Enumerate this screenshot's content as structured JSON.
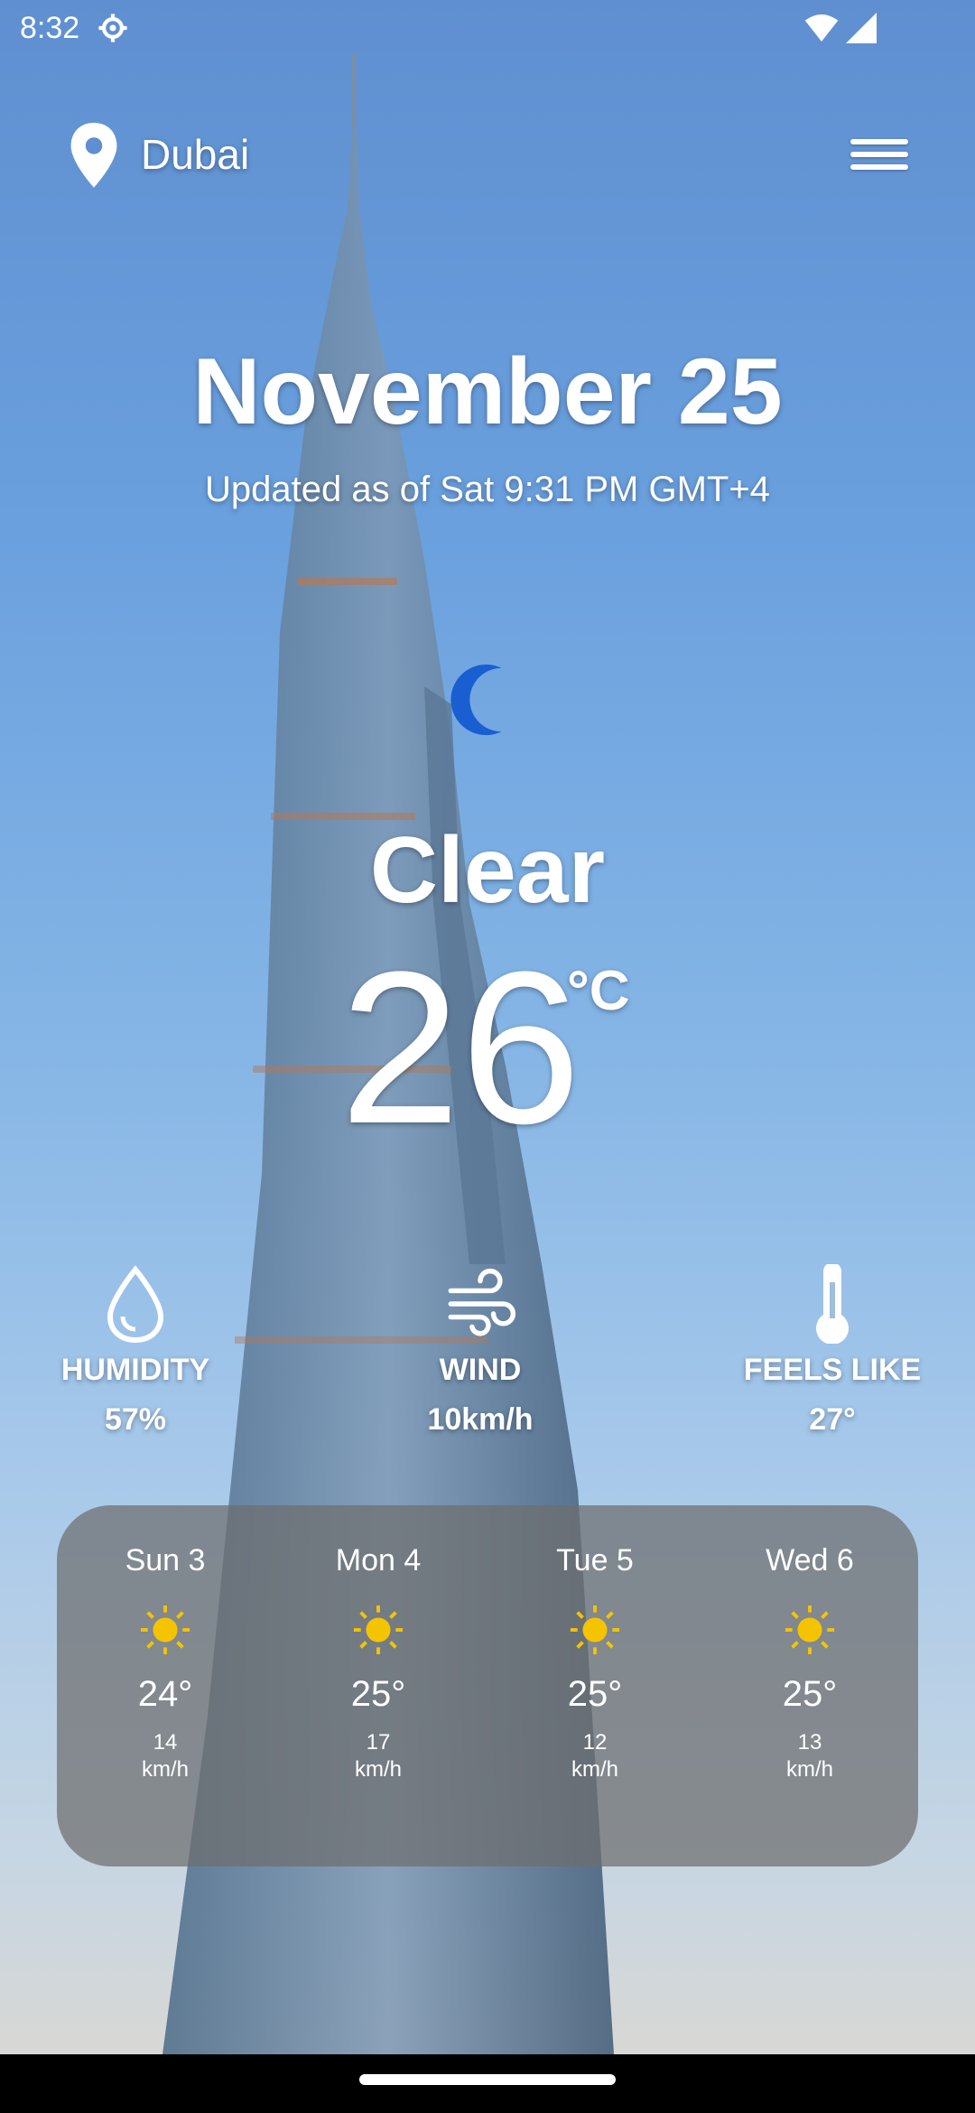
{
  "status": {
    "time": "8:32"
  },
  "location": {
    "city": "Dubai"
  },
  "date": "November 25",
  "updated": "Updated as of Sat 9:31 PM GMT+4",
  "condition": "Clear",
  "temperature": {
    "value": "26",
    "unit": "°C"
  },
  "stats": {
    "humidity": {
      "label": "HUMIDITY",
      "value": "57%"
    },
    "wind": {
      "label": "WIND",
      "value": "10km/h"
    },
    "feels_like": {
      "label": "FEELS LIKE",
      "value": "27°"
    }
  },
  "forecast": [
    {
      "day": "Sun 3",
      "temp": "24°",
      "wind": "14",
      "wind_unit": "km/h",
      "icon": "sun-icon"
    },
    {
      "day": "Mon 4",
      "temp": "25°",
      "wind": "17",
      "wind_unit": "km/h",
      "icon": "sun-icon"
    },
    {
      "day": "Tue 5",
      "temp": "25°",
      "wind": "12",
      "wind_unit": "km/h",
      "icon": "sun-icon"
    },
    {
      "day": "Wed 6",
      "temp": "25°",
      "wind": "13",
      "wind_unit": "km/h",
      "icon": "sun-icon"
    }
  ],
  "colors": {
    "moon": "#1a5fd1",
    "sun": "#f5c400",
    "forecast_panel": "#6e6e6e"
  },
  "icons": {
    "menu": "hamburger-menu-icon",
    "location": "location-pin-icon",
    "condition": "crescent-moon-icon"
  }
}
